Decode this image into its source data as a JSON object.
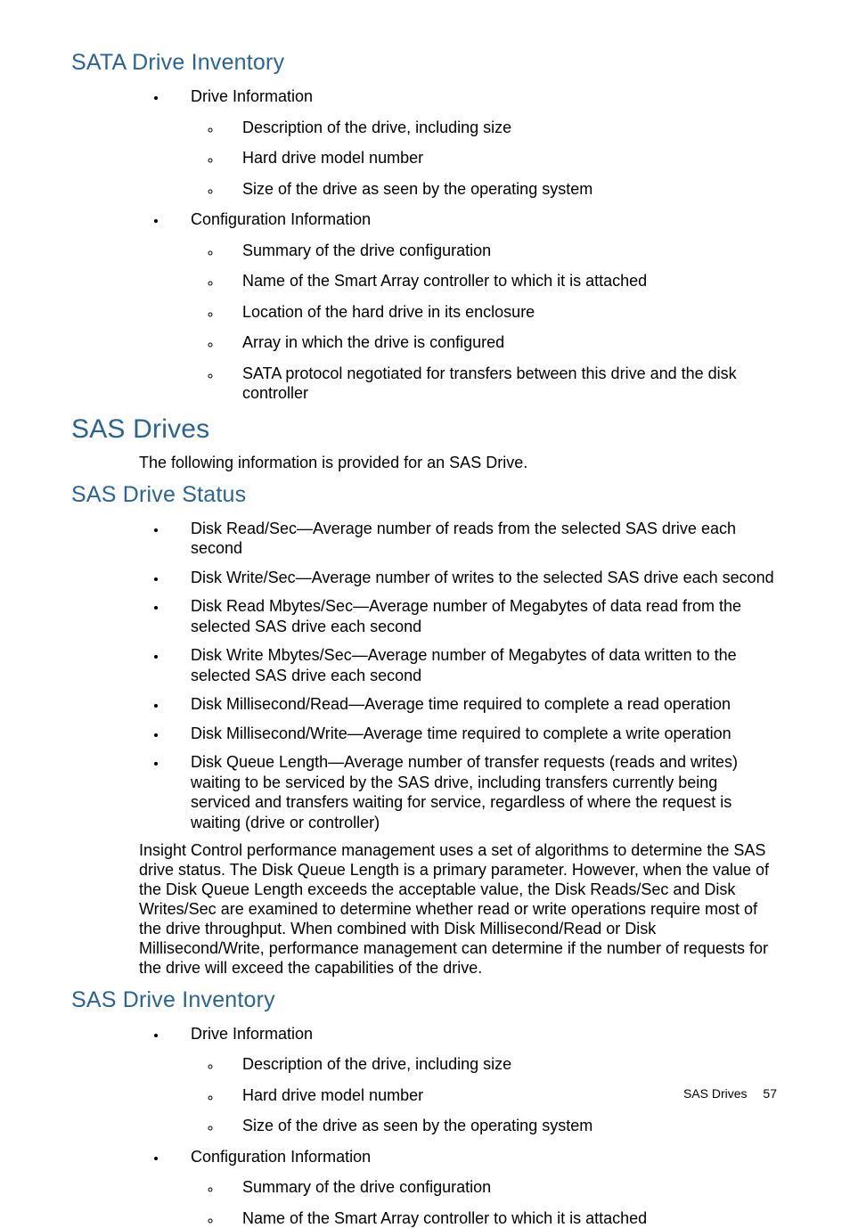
{
  "section_sata_inventory": {
    "heading": "SATA Drive Inventory",
    "items": [
      {
        "label": "Drive Information",
        "sub": [
          "Description of the drive, including size",
          "Hard drive model number",
          "Size of the drive as seen by the operating system"
        ]
      },
      {
        "label": "Configuration Information",
        "sub": [
          "Summary of the drive configuration",
          "Name of the Smart Array controller to which it is attached",
          "Location of the hard drive in its enclosure",
          "Array in which the drive is configured",
          "SATA protocol negotiated for transfers between this drive and the disk controller"
        ]
      }
    ]
  },
  "section_sas": {
    "heading": "SAS Drives",
    "intro": "The following information is provided for an SAS Drive."
  },
  "section_sas_status": {
    "heading": "SAS Drive Status",
    "items": [
      "Disk Read/Sec—Average number of reads from the selected SAS drive each second",
      "Disk Write/Sec—Average number of writes to the selected SAS drive each second",
      "Disk Read Mbytes/Sec—Average number of Megabytes of data read from the selected SAS drive each second",
      "Disk Write Mbytes/Sec—Average number of Megabytes of data written to the selected SAS drive each second",
      "Disk Millisecond/Read—Average time required to complete a read operation",
      "Disk Millisecond/Write—Average time required to complete a write operation",
      "Disk Queue Length—Average number of transfer requests (reads and writes) waiting to be serviced by the SAS drive, including transfers currently being serviced and transfers waiting for service, regardless of where the request is waiting (drive or controller)"
    ],
    "paragraph": "Insight Control performance management uses a set of algorithms to determine the SAS drive status. The Disk Queue Length is a primary parameter. However, when the value of the Disk Queue Length exceeds the acceptable value, the Disk Reads/Sec and Disk Writes/Sec are examined to determine whether read or write operations require most of the drive throughput. When combined with Disk Millisecond/Read or Disk Millisecond/Write, performance management can determine if the number of requests for the drive will exceed the capabilities of the drive."
  },
  "section_sas_inventory": {
    "heading": "SAS Drive Inventory",
    "items": [
      {
        "label": "Drive Information",
        "sub": [
          "Description of the drive, including size",
          "Hard drive model number",
          "Size of the drive as seen by the operating system"
        ]
      },
      {
        "label": "Configuration Information",
        "sub": [
          "Summary of the drive configuration",
          "Name of the Smart Array controller to which it is attached"
        ]
      }
    ]
  },
  "footer": {
    "section": "SAS Drives",
    "page": "57"
  }
}
